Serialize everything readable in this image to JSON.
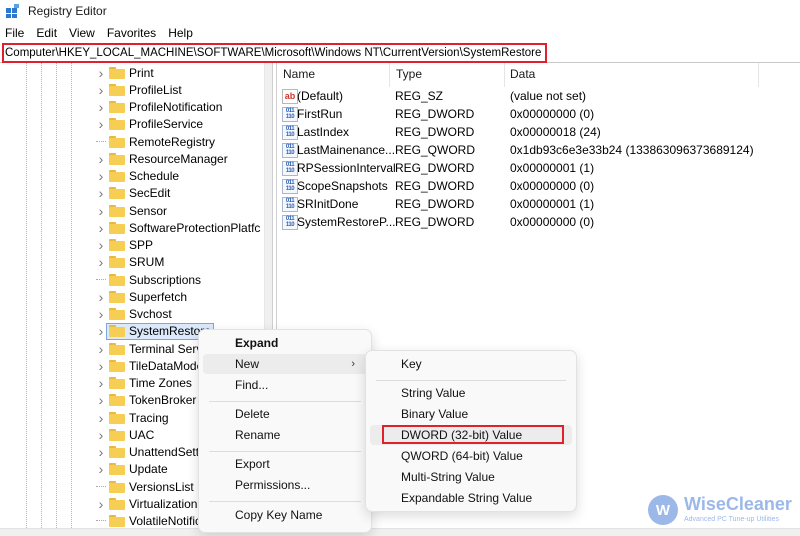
{
  "window": {
    "title": "Registry Editor",
    "icon": "registry-editor-icon"
  },
  "menubar": [
    "File",
    "Edit",
    "View",
    "Favorites",
    "Help"
  ],
  "address": "Computer\\HKEY_LOCAL_MACHINE\\SOFTWARE\\Microsoft\\Windows NT\\CurrentVersion\\SystemRestore",
  "tree": {
    "items": [
      {
        "label": "Print",
        "expandable": true
      },
      {
        "label": "ProfileList",
        "expandable": true
      },
      {
        "label": "ProfileNotification",
        "expandable": true
      },
      {
        "label": "ProfileService",
        "expandable": true
      },
      {
        "label": "RemoteRegistry",
        "expandable": false
      },
      {
        "label": "ResourceManager",
        "expandable": true
      },
      {
        "label": "Schedule",
        "expandable": true
      },
      {
        "label": "SecEdit",
        "expandable": true
      },
      {
        "label": "Sensor",
        "expandable": true
      },
      {
        "label": "SoftwareProtectionPlatfc",
        "expandable": true
      },
      {
        "label": "SPP",
        "expandable": true
      },
      {
        "label": "SRUM",
        "expandable": true
      },
      {
        "label": "Subscriptions",
        "expandable": false
      },
      {
        "label": "Superfetch",
        "expandable": true
      },
      {
        "label": "Svchost",
        "expandable": true
      },
      {
        "label": "SystemRestore",
        "expandable": true,
        "selected": true
      },
      {
        "label": "Terminal Serv",
        "expandable": true
      },
      {
        "label": "TileDataMode",
        "expandable": true
      },
      {
        "label": "Time Zones",
        "expandable": true
      },
      {
        "label": "TokenBroker",
        "expandable": true
      },
      {
        "label": "Tracing",
        "expandable": true
      },
      {
        "label": "UAC",
        "expandable": true
      },
      {
        "label": "UnattendSett",
        "expandable": true
      },
      {
        "label": "Update",
        "expandable": true
      },
      {
        "label": "VersionsList",
        "expandable": false
      },
      {
        "label": "Virtualization",
        "expandable": true
      },
      {
        "label": "VolatileNotific",
        "expandable": false
      }
    ]
  },
  "values": {
    "columns": [
      "Name",
      "Type",
      "Data"
    ],
    "rows": [
      {
        "icon": "string",
        "name": "(Default)",
        "type": "REG_SZ",
        "data": "(value not set)"
      },
      {
        "icon": "binary",
        "name": "FirstRun",
        "type": "REG_DWORD",
        "data": "0x00000000 (0)"
      },
      {
        "icon": "binary",
        "name": "LastIndex",
        "type": "REG_DWORD",
        "data": "0x00000018 (24)"
      },
      {
        "icon": "binary",
        "name": "LastMainenance...",
        "type": "REG_QWORD",
        "data": "0x1db93c6e3e33b24 (133863096373689124)"
      },
      {
        "icon": "binary",
        "name": "RPSessionInterval",
        "type": "REG_DWORD",
        "data": "0x00000001 (1)"
      },
      {
        "icon": "binary",
        "name": "ScopeSnapshots",
        "type": "REG_DWORD",
        "data": "0x00000000 (0)"
      },
      {
        "icon": "binary",
        "name": "SRInitDone",
        "type": "REG_DWORD",
        "data": "0x00000001 (1)"
      },
      {
        "icon": "binary",
        "name": "SystemRestoreP...",
        "type": "REG_DWORD",
        "data": "0x00000000 (0)"
      }
    ]
  },
  "context_menu": {
    "items": [
      "Expand",
      "New",
      "Find...",
      "Delete",
      "Rename",
      "Export",
      "Permissions...",
      "Copy Key Name"
    ]
  },
  "submenu": {
    "items": [
      "Key",
      "String Value",
      "Binary Value",
      "DWORD (32-bit) Value",
      "QWORD (64-bit) Value",
      "Multi-String Value",
      "Expandable String Value"
    ],
    "highlighted": "DWORD (32-bit) Value"
  },
  "watermark": {
    "letter": "W",
    "name": "WiseCleaner",
    "tagline": "Advanced PC Tune-up Utilities"
  },
  "colors": {
    "highlight_box": "#e0202a",
    "selection": "#dbe9fb",
    "accent": "#4a7fd6"
  }
}
